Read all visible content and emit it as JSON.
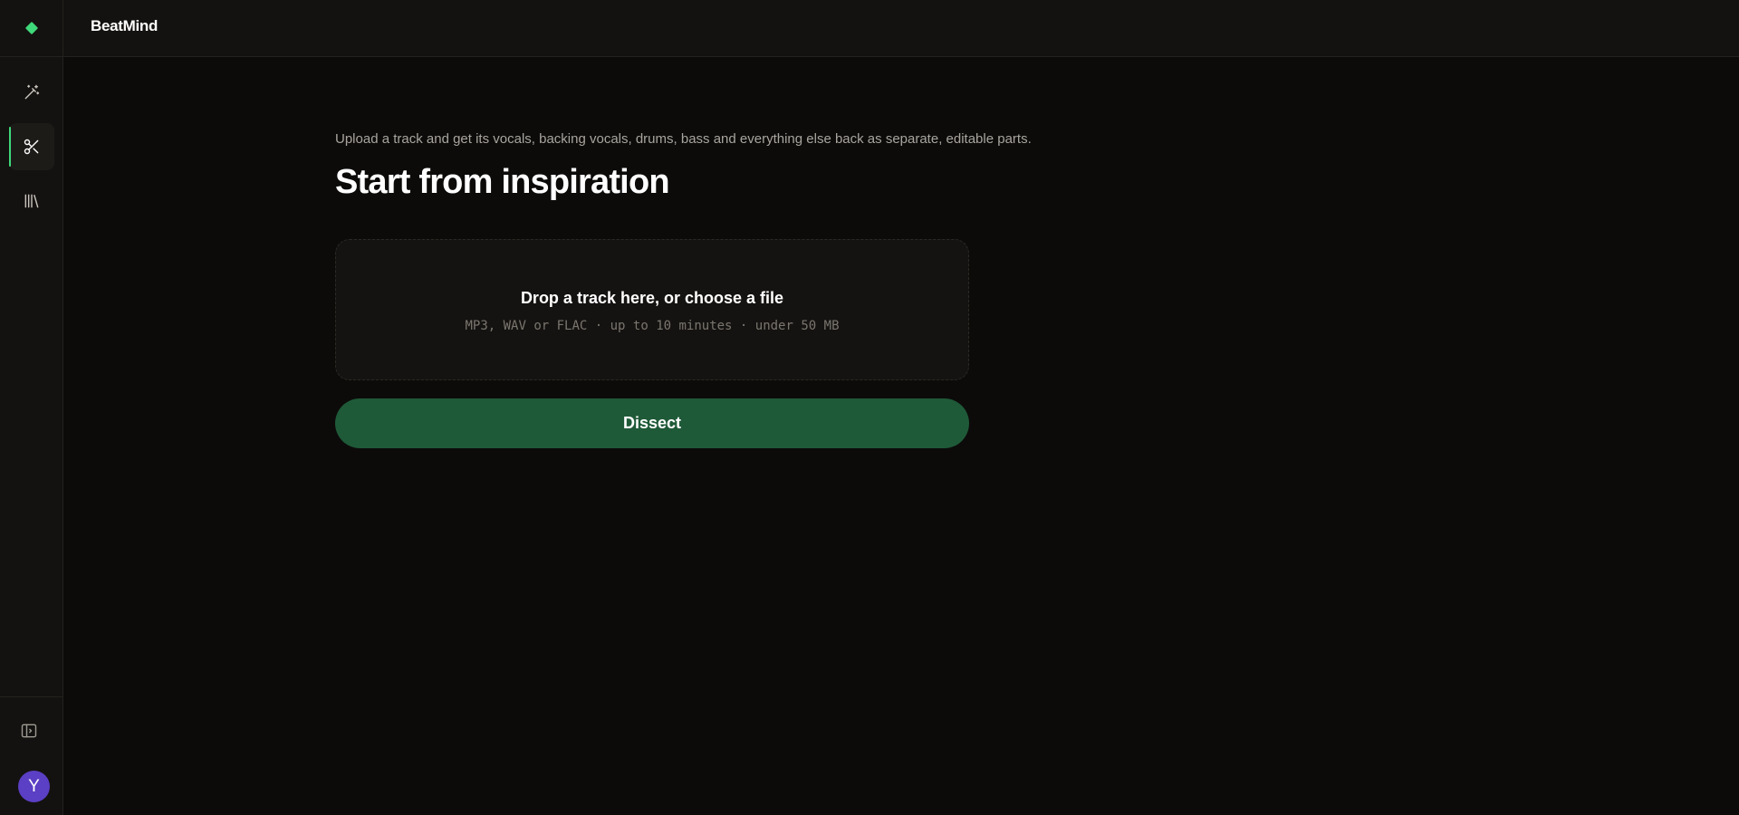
{
  "app": {
    "title": "BeatMind",
    "accent_color": "#3fd87a",
    "button_color": "#1f5a38",
    "avatar_color": "#5b3fc4"
  },
  "sidebar": {
    "logo_icon": "diamond-icon",
    "items": [
      {
        "name": "magic-wand-icon",
        "active": false
      },
      {
        "name": "scissors-icon",
        "active": true
      },
      {
        "name": "library-icon",
        "active": false
      }
    ],
    "toggle_icon": "sidebar-toggle-icon",
    "avatar_initial": "Y"
  },
  "main": {
    "subtitle": "Upload a track and get its vocals, backing vocals, drums, bass and everything else back as separate, editable parts.",
    "title": "Start from inspiration",
    "dropzone": {
      "title": "Drop a track here, or choose a file",
      "hint": "MP3, WAV or FLAC · up to 10 minutes · under 50 MB"
    },
    "action_label": "Dissect"
  }
}
